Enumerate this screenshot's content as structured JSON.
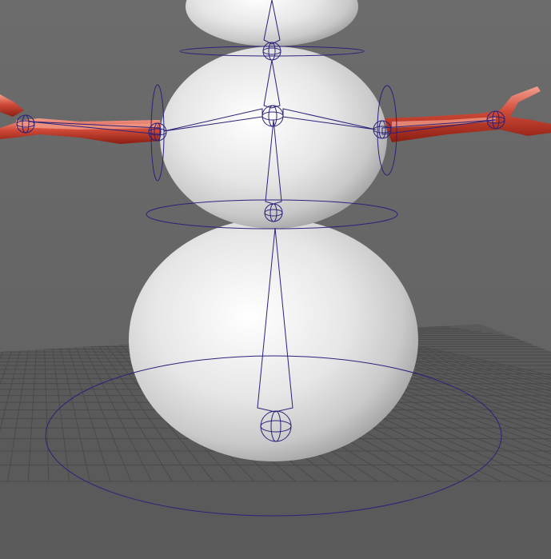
{
  "viewport": {
    "background_color": "#6b6b6b",
    "grid_color": "#4a4a4a",
    "grid_fill_color": "#5a5a5a"
  },
  "model": {
    "body_color": "#e2e2e2",
    "arm_color": "#c23a2a",
    "arm_highlight_color": "#f08a7a",
    "joint_color": "#2a237a"
  },
  "icons": [
    "joint-icon",
    "ik-ring-icon",
    "root-control-icon",
    "twig-arm-icon"
  ]
}
